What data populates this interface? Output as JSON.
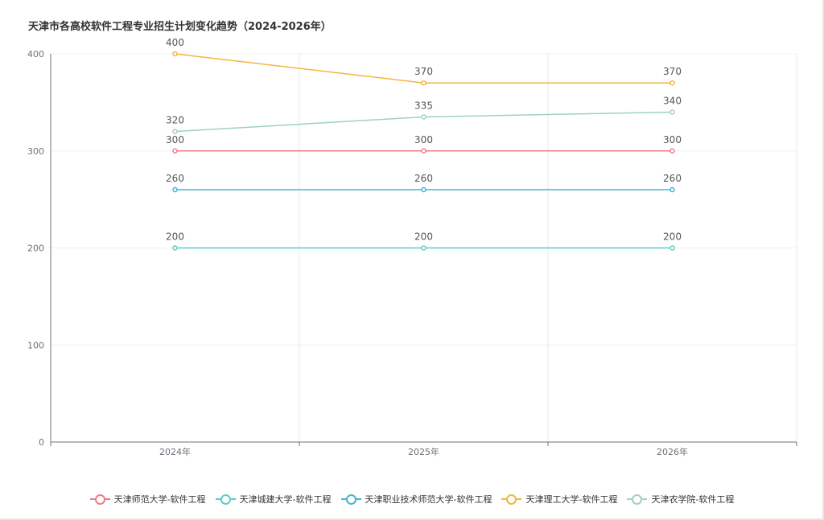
{
  "chart_data": {
    "type": "line",
    "title": "天津市各高校软件工程专业招生计划变化趋势（2024-2026年）",
    "categories": [
      "2024年",
      "2025年",
      "2026年"
    ],
    "ylim": [
      0,
      400
    ],
    "yticks": [
      0,
      100,
      200,
      300,
      400
    ],
    "grid": true,
    "legend_position": "bottom",
    "series": [
      {
        "name": "天津师范大学-软件工程",
        "values": [
          300,
          300,
          300
        ],
        "color": "#f07c82"
      },
      {
        "name": "天津城建大学-软件工程",
        "values": [
          200,
          200,
          200
        ],
        "color": "#5ccdc9"
      },
      {
        "name": "天津职业技术师范大学-软件工程",
        "values": [
          260,
          260,
          260
        ],
        "color": "#45b5d6"
      },
      {
        "name": "天津理工大学-软件工程",
        "values": [
          400,
          370,
          370
        ],
        "color": "#f5b53f"
      },
      {
        "name": "天津农学院-软件工程",
        "values": [
          320,
          335,
          340
        ],
        "color": "#9fd4b8"
      }
    ]
  }
}
